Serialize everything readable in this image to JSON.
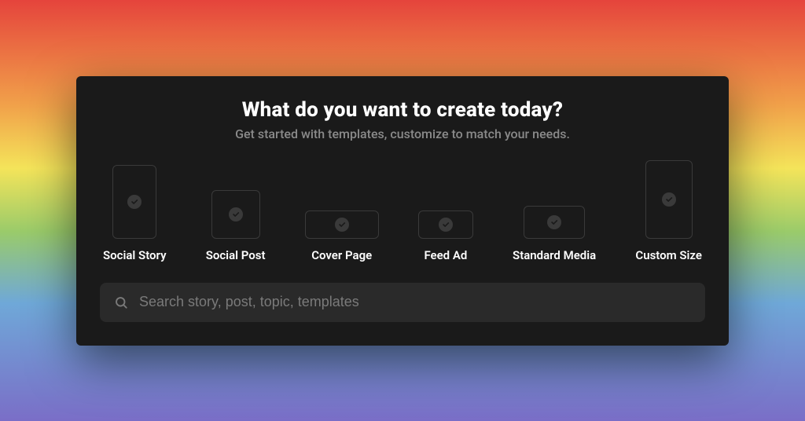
{
  "title": "What do you want to create today?",
  "subtitle": "Get started with templates, customize to match your needs.",
  "templates": [
    {
      "label": "Social Story"
    },
    {
      "label": "Social Post"
    },
    {
      "label": "Cover Page"
    },
    {
      "label": "Feed Ad"
    },
    {
      "label": "Standard Media"
    },
    {
      "label": "Custom Size"
    }
  ],
  "search": {
    "placeholder": "Search story, post, topic, templates"
  }
}
